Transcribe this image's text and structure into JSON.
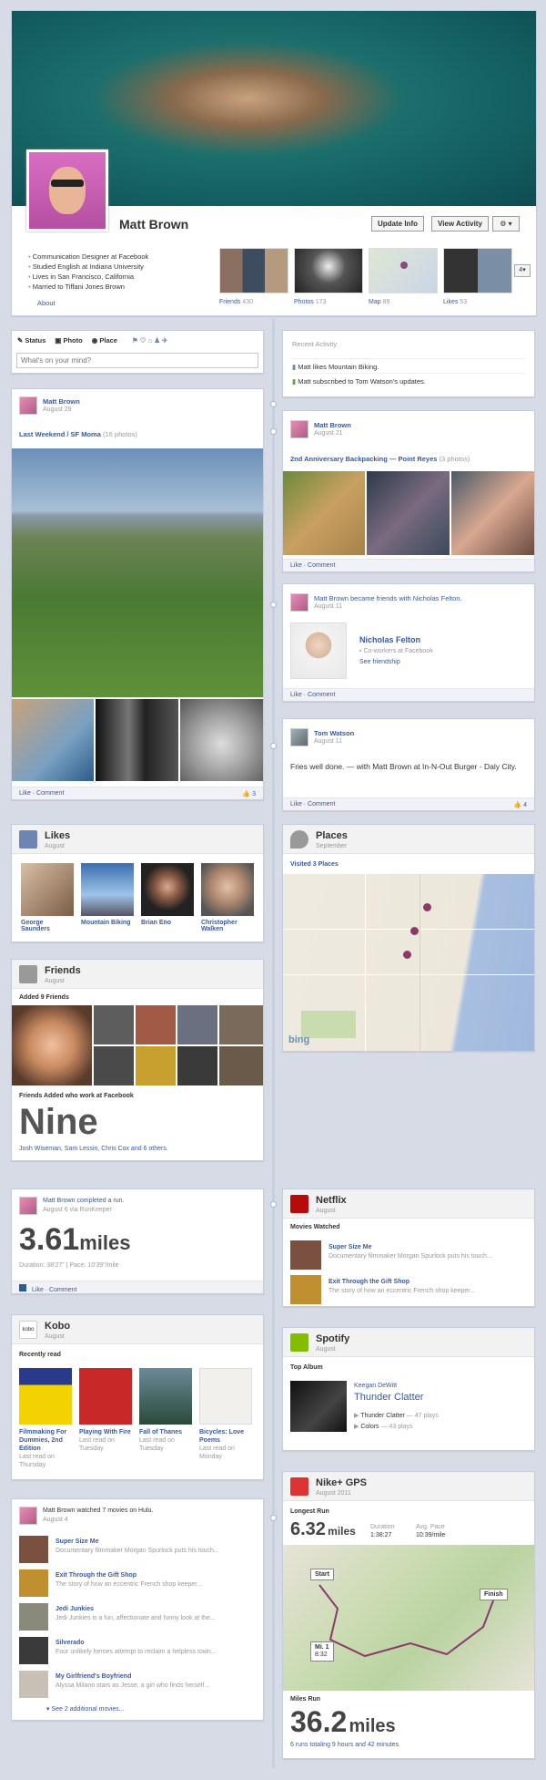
{
  "profile": {
    "name": "Matt Brown",
    "update_info": "Update Info",
    "view_activity": "View Activity",
    "info": [
      "Communication Designer at Facebook",
      "Studied English at Indiana University",
      "Lives in San Francisco, California",
      "Married to Tiffani Jones Brown"
    ],
    "about": "About",
    "tabs": [
      {
        "label": "Friends",
        "count": "430"
      },
      {
        "label": "Photos",
        "count": "173"
      },
      {
        "label": "Map",
        "count": "89"
      },
      {
        "label": "Likes",
        "count": "53"
      }
    ],
    "more_count": "4"
  },
  "composer": {
    "status": "Status",
    "photo": "Photo",
    "place": "Place",
    "placeholder": "What's on your mind?"
  },
  "recent": {
    "title": "Recent Activity",
    "items": [
      "Matt likes Mountain Biking.",
      "Matt subscribed to Tom Watson's updates."
    ]
  },
  "post1": {
    "name": "Matt Brown",
    "date": "August 29",
    "album": "Last Weekend / SF Moma",
    "count": "(16 photos)",
    "like_comment": "Like · Comment",
    "likes": "3"
  },
  "post2": {
    "name": "Matt Brown",
    "date": "August 21",
    "album": "2nd Anniversary Backpacking — Point Reyes",
    "count": "(3 photos)",
    "like_comment": "Like · Comment"
  },
  "post3": {
    "text": "Matt Brown became friends with Nicholas Felton.",
    "date": "August 11",
    "friend": "Nicholas Felton",
    "sub": "Co-workers at Facebook",
    "see": "See friendship",
    "like_comment": "Like · Comment"
  },
  "post4": {
    "name": "Tom Watson",
    "date": "August 11",
    "text": "Fries well done. — with Matt Brown at In-N-Out Burger - Daly City.",
    "like_comment": "Like · Comment",
    "likes": "4"
  },
  "likes": {
    "title": "Likes",
    "date": "August",
    "items": [
      "George Saunders",
      "Mountain Biking",
      "Brian Eno",
      "Christopher Walken"
    ]
  },
  "places": {
    "title": "Places",
    "date": "September",
    "visited": "Visited 3 Places"
  },
  "friends": {
    "title": "Friends",
    "date": "August",
    "added": "Added 9 Friends",
    "work_label": "Friends Added who work at Facebook",
    "big": "Nine",
    "names": "Josh Wiseman, Sam Lessin, Chris Cox and 6 others."
  },
  "run": {
    "text": "Matt Brown completed a run.",
    "date": "August 6 via RunKeeper",
    "value": "3.61",
    "unit": "miles",
    "detail": "Duration: 38'27\" | Pace: 10'39\"/mile",
    "like_comment": "Like · Comment"
  },
  "netflix": {
    "title": "Netflix",
    "date": "August",
    "label": "Movies Watched",
    "items": [
      {
        "t": "Super Size Me",
        "d": "Documentary filmmaker Morgan Spurlock puts his touch..."
      },
      {
        "t": "Exit Through the Gift Shop",
        "d": "The story of how an eccentric French shop keeper..."
      }
    ]
  },
  "kobo": {
    "title": "Kobo",
    "date": "August",
    "label": "Recently read",
    "books": [
      {
        "t": "Filmmaking For Dummies, 2nd Edition",
        "d": "Last read on Thursday"
      },
      {
        "t": "Playing With Fire",
        "d": "Last read on Tuesday"
      },
      {
        "t": "Fall of Thanes",
        "d": "Last read on Tuesday"
      },
      {
        "t": "Bicycles: Love Poems",
        "d": "Last read on Monday"
      }
    ]
  },
  "spotify": {
    "title": "Spotify",
    "date": "August",
    "label": "Top Album",
    "artist": "Keegan DeWitt",
    "album": "Thunder Clatter",
    "tracks": [
      {
        "t": "Thunder Clatter",
        "p": "— 47 plays"
      },
      {
        "t": "Colors",
        "p": "— 43 plays"
      }
    ]
  },
  "hulu": {
    "text": "Matt Brown watched 7 movies on Hulu.",
    "date": "August 4",
    "items": [
      {
        "t": "Super Size Me",
        "d": "Documentary filmmaker Morgan Spurlock puts his touch..."
      },
      {
        "t": "Exit Through the Gift Shop",
        "d": "The story of how an eccentric French shop keeper..."
      },
      {
        "t": "Jedi Junkies",
        "d": "Jedi Junkies is a fun, affectionate and funny look at the..."
      },
      {
        "t": "Silverado",
        "d": "Four unlikely heroes attempt to reclaim a helpless town..."
      },
      {
        "t": "My Girlfriend's Boyfriend",
        "d": "Alyssa Milano stars as Jesse, a girl who finds herself..."
      }
    ],
    "more": "See 2 additional movies..."
  },
  "nike": {
    "title": "Nike+ GPS",
    "date": "August 2011",
    "label": "Longest Run",
    "value": "6.32",
    "unit": "miles",
    "dur_l": "Duration",
    "dur": "1:38:27",
    "pace_l": "Avg. Pace",
    "pace": "10:39/mile",
    "start": "Start",
    "finish": "Finish",
    "mi_l": "Mi. 1",
    "mi_v": "8:32",
    "miles_run": "Miles Run",
    "total": "36.2",
    "total_unit": "miles",
    "summary": "6 runs totaling 9 hours and 42 minutes"
  },
  "colors": {
    "link": "#3b5998",
    "brand": "#3b5998",
    "netflix": "#b9090b",
    "spotify": "#84bd00",
    "nike": "#d33"
  }
}
